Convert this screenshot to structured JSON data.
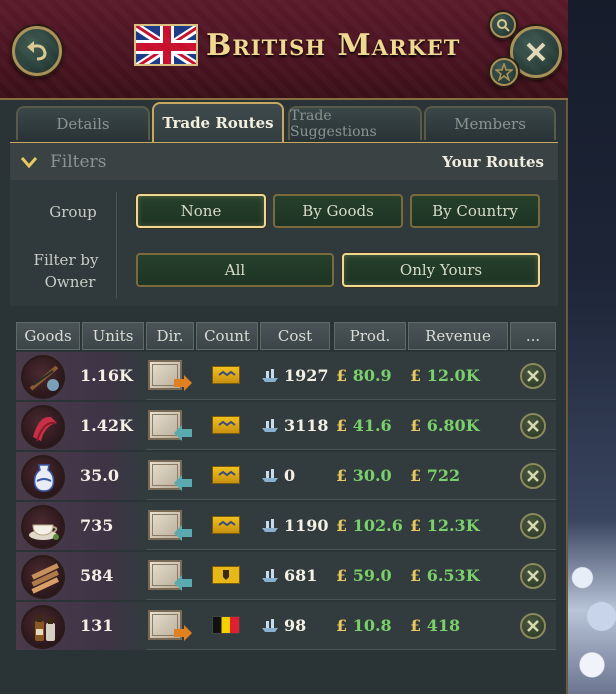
{
  "window": {
    "title": "British Market"
  },
  "tabs": [
    {
      "label": "Details",
      "active": false
    },
    {
      "label": "Trade Routes",
      "active": true
    },
    {
      "label": "Trade Suggestions",
      "active": false
    },
    {
      "label": "Members",
      "active": false
    }
  ],
  "filters": {
    "header_label": "Filters",
    "right_label": "Your Routes",
    "group_label": "Group",
    "group_options": [
      "None",
      "By Goods",
      "By Country"
    ],
    "group_selected": "None",
    "owner_label_1": "Filter by",
    "owner_label_2": "Owner",
    "owner_options": [
      "All",
      "Only Yours"
    ],
    "owner_selected": "Only Yours"
  },
  "table": {
    "columns": [
      "Goods",
      "Units",
      "Dir.",
      "Count",
      "Cost",
      "Prod.",
      "Revenue",
      "..."
    ],
    "rows": [
      {
        "goods_icon": "small-arms-icon",
        "units": "1.16K",
        "direction": "export",
        "country_icon": "yellow-flag-icon",
        "cost": "1927",
        "prod": "80.9",
        "revenue": "12.0K"
      },
      {
        "goods_icon": "fabric-icon",
        "units": "1.42K",
        "direction": "import",
        "country_icon": "yellow-flag-icon",
        "cost": "3118",
        "prod": "41.6",
        "revenue": "6.80K"
      },
      {
        "goods_icon": "porcelain-icon",
        "units": "35.0",
        "direction": "import",
        "country_icon": "yellow-flag-icon",
        "cost": "0",
        "prod": "30.0",
        "revenue": "722"
      },
      {
        "goods_icon": "tea-icon",
        "units": "735",
        "direction": "import",
        "country_icon": "yellow-flag-icon",
        "cost": "1190",
        "prod": "102.6",
        "revenue": "12.3K"
      },
      {
        "goods_icon": "wood-icon",
        "units": "584",
        "direction": "import",
        "country_icon": "yellow-crest-flag-icon",
        "cost": "681",
        "prod": "59.0",
        "revenue": "6.53K"
      },
      {
        "goods_icon": "liquor-icon",
        "units": "131",
        "direction": "export",
        "country_icon": "belgium-flag-icon",
        "cost": "98",
        "prod": "10.8",
        "revenue": "418"
      }
    ]
  },
  "colors": {
    "accent_gold": "#f0d890",
    "positive_green": "#7ad06a",
    "header_maroon": "#5a1a2a",
    "export_arrow": "#e08020",
    "import_arrow": "#5aaab0"
  },
  "currency_symbol": "£"
}
